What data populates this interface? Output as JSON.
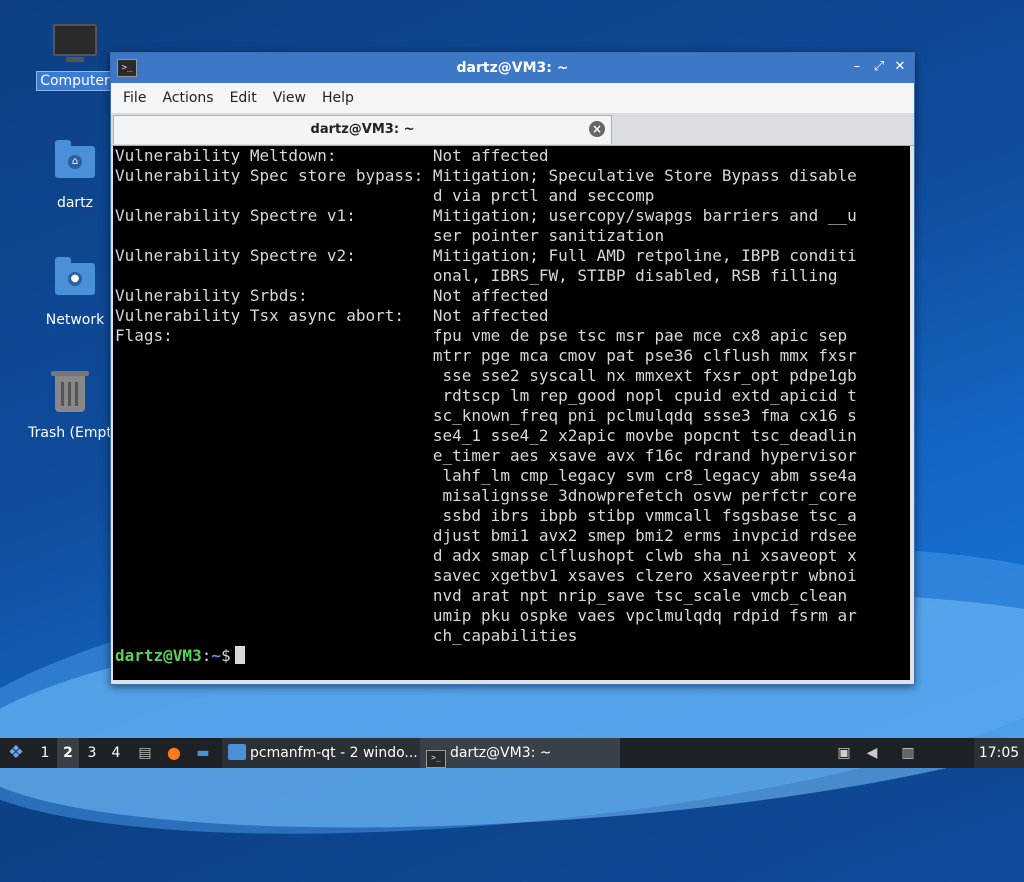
{
  "desktop": {
    "icons": [
      {
        "label": "Computer"
      },
      {
        "label": "dartz"
      },
      {
        "label": "Network"
      },
      {
        "label": "Trash (Empt"
      }
    ]
  },
  "window": {
    "title": "dartz@VM3: ~",
    "menu": [
      "File",
      "Actions",
      "Edit",
      "View",
      "Help"
    ],
    "tab_label": "dartz@VM3: ~",
    "terminal_lines": [
      "Vulnerability Meltdown:          Not affected",
      "Vulnerability Spec store bypass: Mitigation; Speculative Store Bypass disable",
      "                                 d via prctl and seccomp",
      "Vulnerability Spectre v1:        Mitigation; usercopy/swapgs barriers and __u",
      "                                 ser pointer sanitization",
      "Vulnerability Spectre v2:        Mitigation; Full AMD retpoline, IBPB conditi",
      "                                 onal, IBRS_FW, STIBP disabled, RSB filling",
      "Vulnerability Srbds:             Not affected",
      "Vulnerability Tsx async abort:   Not affected",
      "Flags:                           fpu vme de pse tsc msr pae mce cx8 apic sep",
      "                                 mtrr pge mca cmov pat pse36 clflush mmx fxsr",
      "                                  sse sse2 syscall nx mmxext fxsr_opt pdpe1gb",
      "                                  rdtscp lm rep_good nopl cpuid extd_apicid t",
      "                                 sc_known_freq pni pclmulqdq ssse3 fma cx16 s",
      "                                 se4_1 sse4_2 x2apic movbe popcnt tsc_deadlin",
      "                                 e_timer aes xsave avx f16c rdrand hypervisor",
      "                                  lahf_lm cmp_legacy svm cr8_legacy abm sse4a",
      "                                  misalignsse 3dnowprefetch osvw perfctr_core",
      "                                  ssbd ibrs ibpb stibp vmmcall fsgsbase tsc_a",
      "                                 djust bmi1 avx2 smep bmi2 erms invpcid rdsee",
      "                                 d adx smap clflushopt clwb sha_ni xsaveopt x",
      "                                 savec xgetbv1 xsaves clzero xsaveerptr wbnoi",
      "                                 nvd arat npt nrip_save tsc_scale vmcb_clean",
      "                                 umip pku ospke vaes vpclmulqdq rdpid fsrm ar",
      "                                 ch_capabilities"
    ],
    "prompt_user": "dartz@VM3",
    "prompt_sep": ":",
    "prompt_path": "~",
    "prompt_symbol": "$"
  },
  "taskbar": {
    "workspaces": [
      "1",
      "2",
      "3",
      "4"
    ],
    "active_workspace": "2",
    "tasks": [
      {
        "label": "pcmanfm-qt - 2 windo...",
        "icon": "folder-icon"
      },
      {
        "label": "dartz@VM3: ~",
        "icon": "terminal-icon"
      }
    ],
    "clock": "17:05"
  },
  "colors": {
    "titlebar": "#3d78c6",
    "prompt_user": "#5bd05b",
    "prompt_path": "#5b8ff0",
    "terminal_bg": "#000000"
  }
}
